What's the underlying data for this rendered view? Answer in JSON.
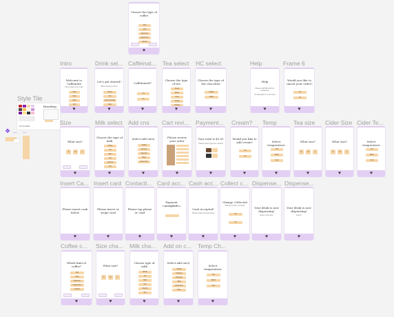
{
  "labels": {
    "style_tile": "Style Tile",
    "intro": "Intro",
    "drink_sel": "Drink sel...",
    "caffeinat": "Caffeinat...",
    "tea_select": "Tea select",
    "hc_select": "HC select",
    "help": "Help",
    "frame6": "Frame 6",
    "size": "Size",
    "milk_select": "Milk select",
    "add_cns": "Add cns",
    "cart_revi": "Cart revi...",
    "payment": "Payment...",
    "cream": "Cream?",
    "temp": "Temp",
    "tea_size": "Tea size",
    "cider_size": "Cider Size",
    "cider_te": "Cider Te...",
    "insert_ca": "Insert Ca...",
    "insert_card": "Insert card",
    "contactl": "Contactl...",
    "card_acc": "Card acc...",
    "cash_acc": "Cash acc...",
    "collect_c": "Collect c...",
    "dispense1": "Dispense...",
    "dispense2": "Dispense...",
    "coffee_c": "Coffee c...",
    "size_cha": "Size cha...",
    "milk_cha": "Milk cha...",
    "add_on_c": "Add on c...",
    "temp_ch": "Temp Ch...",
    "dots1": "...",
    "dots2": "..."
  },
  "style_tile": {
    "title": "Branding",
    "footer": "22 Fa 2023"
  },
  "frames": {
    "top": {
      "title": "Choose the type of coffee",
      "buttons": [
        "Drip",
        "Latte",
        "Espresso",
        "Cappuccino",
        "Mocha"
      ]
    },
    "intro": {
      "title": "Welcome to Caffeinate",
      "sub": "Tap to begin your order",
      "buttons": [
        "Start",
        "Help",
        "Order",
        "Exit"
      ]
    },
    "drink": {
      "title": "Let's get started!",
      "sub": "What would you like?",
      "buttons": [
        "Coffee",
        "Tea",
        "Hot Chocolate",
        "Cider"
      ]
    },
    "caff": {
      "title": "Caffeinated?",
      "buttons": [
        "Yes",
        "No"
      ]
    },
    "tea": {
      "title": "Choose the type of tea",
      "buttons": [
        "Green",
        "Black",
        "Chai",
        "Herbal",
        "Oolong"
      ]
    },
    "hc": {
      "title": "Choose the type of hot chocolate",
      "buttons": [
        "Classic",
        "White"
      ]
    },
    "help": {
      "title": "Help",
      "sub": "Please call 555-0123 for assistance",
      "sub2": "An attendant is on the way"
    },
    "frame6": {
      "title": "Would you like to cancel your order?",
      "buttons": [
        "Yes",
        "No"
      ]
    },
    "size": {
      "title": "What size?",
      "squares": [
        "S",
        "M",
        "L"
      ]
    },
    "milk": {
      "title": "Choose the type of milk",
      "buttons": [
        "Whole",
        "2%",
        "Skim",
        "Oat",
        "Almond",
        "Soy"
      ]
    },
    "addcns": {
      "title": "Select add on(s)",
      "buttons": [
        "Vanilla",
        "Caramel",
        "Hazelnut",
        "Whip",
        "Extra Shot"
      ]
    },
    "cart": {
      "title": "Please review your order"
    },
    "payment": {
      "title": "Your total is $3.00",
      "sub": "Please select payment method"
    },
    "cream": {
      "title": "Would you like to add cream?",
      "buttons": [
        "Yes",
        "No"
      ]
    },
    "temp": {
      "title": "Select temperature",
      "buttons": [
        "Hot",
        "Warm",
        "Iced"
      ]
    },
    "teasize": {
      "title": "What size?",
      "squares": [
        "S",
        "M",
        "L"
      ]
    },
    "cidersize": {
      "title": "What size?",
      "squares": [
        "S",
        "M",
        "L"
      ]
    },
    "cidertemp": {
      "title": "Select temperature",
      "buttons": [
        "Hot",
        "Warm",
        "Cold"
      ]
    },
    "insertcash": {
      "title": "Please insert cash below"
    },
    "insertcard": {
      "title": "Please insert or swipe card"
    },
    "contactless": {
      "title": "Please tap phone or card"
    },
    "cardacc": {
      "title": "Payment accepted!",
      "sub": "Dispensing drink shortly"
    },
    "cashacc": {
      "title": "Cash Accepted!",
      "sub": "Please collect change below"
    },
    "collect": {
      "title": "Change Collected",
      "sub": "Would you like a receipt?",
      "buttons": [
        "Yes",
        "No"
      ]
    },
    "disp1": {
      "title": "Your drink is now dispensing!",
      "sub": "Have a nice day!"
    },
    "disp2": {
      "title": "Your drink is now dispensing!",
      "sub": "Enjoy!"
    },
    "coffeechange": {
      "title": "Which kind of coffee?",
      "buttons": [
        "Drip",
        "Latte",
        "Espresso",
        "Cappuccino",
        "Mocha"
      ]
    },
    "sizechange": {
      "title": "What size?",
      "squares": [
        "S",
        "M",
        "L"
      ]
    },
    "milkchange": {
      "title": "Choose type of milk",
      "buttons": [
        "Whole",
        "2%",
        "Skim",
        "Oat",
        "Almond",
        "Soy"
      ]
    },
    "addonchange": {
      "title": "Select add on(s)",
      "buttons": [
        "Vanilla",
        "Caramel",
        "Hazelnut",
        "Whip",
        "Extra Shot",
        "None"
      ]
    },
    "tempchange": {
      "title": "Select temperature",
      "buttons": [
        "Hot",
        "Warm",
        "Iced"
      ]
    }
  },
  "heart_icon": "♥",
  "colors": {
    "accent": "#e3cff3",
    "button": "#f6d6a8",
    "heart": "#4a3a44"
  }
}
